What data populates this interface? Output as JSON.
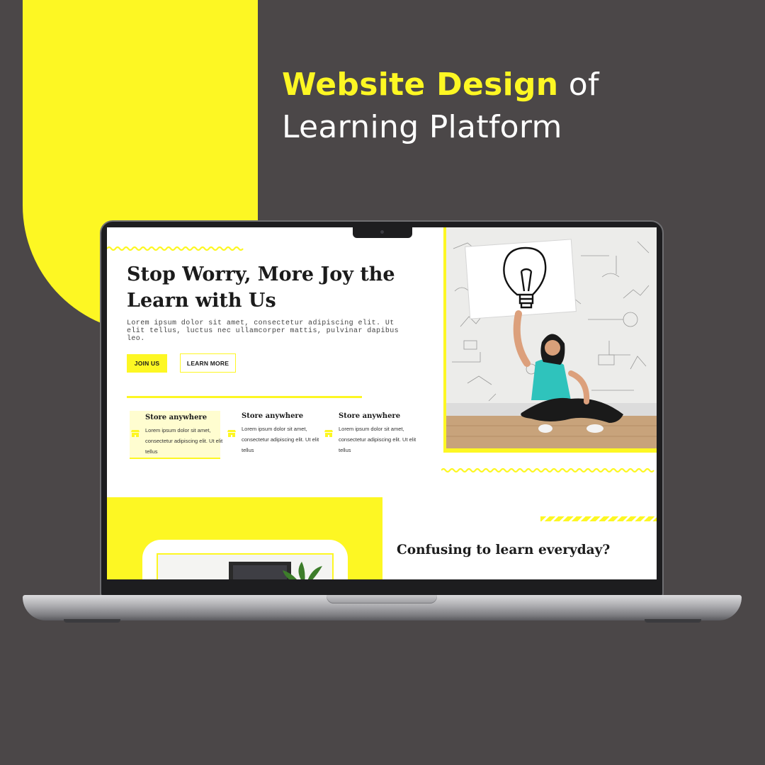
{
  "colors": {
    "background": "#4b4748",
    "accent": "#fdf723",
    "text": "#1b1b1b",
    "white": "#ffffff"
  },
  "headline": {
    "highlight": "Website Design",
    "rest": " of Learning Platform"
  },
  "website": {
    "hero": {
      "title": "Stop Worry, More Joy the Learn with Us",
      "subtitle": "Lorem ipsum dolor sit amet, consectetur adipiscing elit. Ut elit tellus, luctus nec ullamcorper mattis, pulvinar dapibus leo.",
      "join_button": "JOIN US",
      "learn_button": "LEARN MORE"
    },
    "features": [
      {
        "title": "Store anywhere",
        "text": "Lorem ipsum dolor sit amet, consectetur adipiscing elit. Ut elit tellus",
        "icon": "store-icon",
        "active": true
      },
      {
        "title": "Store anywhere",
        "text": "Lorem ipsum dolor sit amet, consectetur adipiscing elit. Ut elit tellus",
        "icon": "store-icon",
        "active": false
      },
      {
        "title": "Store anywhere",
        "text": "Lorem ipsum dolor sit amet, consectetur adipiscing elit. Ut elit tellus",
        "icon": "store-icon",
        "active": false
      }
    ],
    "section2": {
      "title": "Confusing to learn everyday?"
    }
  }
}
